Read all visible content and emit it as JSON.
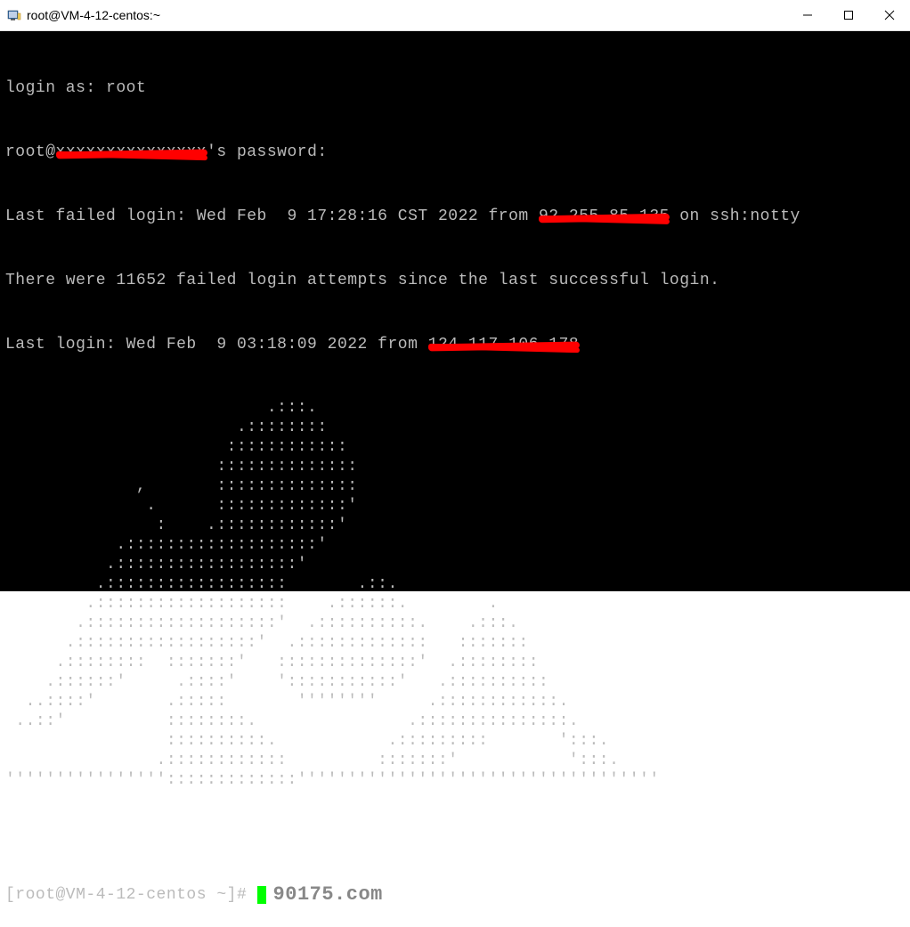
{
  "titlebar": {
    "title": "root@VM-4-12-centos:~"
  },
  "terminal": {
    "login_as": "login as: root",
    "root_at": "root@",
    "password_suffix": "'s password:",
    "last_failed_prefix": "Last failed login: Wed Feb  9 17:28:16 CST 2022 from ",
    "last_failed_ip_masked": "92.255.85.135",
    "last_failed_suffix": " on ssh:notty",
    "failed_attempts": "There were 11652 failed login attempts since the last successful login.",
    "last_login_prefix": "Last login: Wed Feb  9 03:18:09 2022 from ",
    "last_login_ip_masked": "124.117.106.178",
    "ascii_art": "                          .:::.\n                       .::::::::\n                      ::::::::::::\n                     ::::::::::::::\n             ,       ::::::::::::::\n              .      :::::::::::::'\n               :    .::::::::::::'\n           .:::::::::::::::::::'\n          .::::::::::::::::::'\n         .::::::::::::::::::       .::.\n        .:::::::::::::::::::    .::::::.        .\n       .:::::::::::::::::::'  .::::::::::.    .:::.\n      .::::::::::::::::::'  .:::::::::::::   :::::::\n     .::::::::  :::::::'   ::::::::::::::'  .::::::::\n    .::::::'     .::::'    ':::::::::::'   .::::::::::\n  ..::::'       .:::::       ''''''''     .::::::::::::.\n ..::'          ::::::::.               .:::::::::::::::.\n                ::::::::::.           .:::::::::       ':::.\n               .::::::::::::         :::::::'           ':::.\n'''''''''''''''':::::::::::::''''''''''''''''''''''''''''''''''''",
    "prompt": "[root@VM-4-12-centos ~]# ",
    "watermark": "90175.com"
  }
}
